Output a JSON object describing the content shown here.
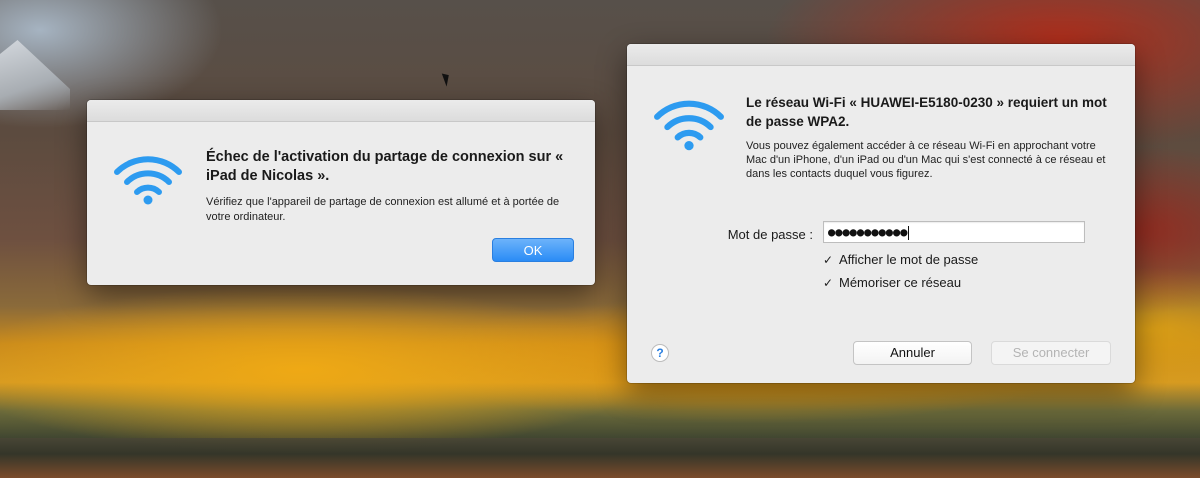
{
  "colors": {
    "accent": "#2a8cf6",
    "wifi_icon": "#2d9bf0",
    "dialog_bg": "#ececec"
  },
  "dialog_hotspot_error": {
    "icon": "wifi-icon",
    "headline": "Échec de l'activation du partage de connexion sur « iPad de Nicolas ».",
    "body": "Vérifiez que l'appareil de partage de connexion est allumé et à portée de votre ordinateur.",
    "ok_label": "OK"
  },
  "dialog_wifi_password": {
    "icon": "wifi-icon",
    "headline": "Le réseau Wi-Fi « HUAWEI-E5180-0230 » requiert un mot de passe WPA2.",
    "body": "Vous pouvez également accéder à ce réseau Wi-Fi en approchant votre Mac d'un iPhone, d'un iPad ou d'un Mac qui s'est connecté à ce réseau et dans les contacts duquel vous figurez.",
    "password_label": "Mot de passe :",
    "password_value": "●●●●●●●●●●●",
    "show_password_label": "Afficher le mot de passe",
    "show_password_checked": true,
    "remember_network_label": "Mémoriser ce réseau",
    "remember_network_checked": true,
    "help_label": "?",
    "cancel_label": "Annuler",
    "connect_label": "Se connecter"
  }
}
